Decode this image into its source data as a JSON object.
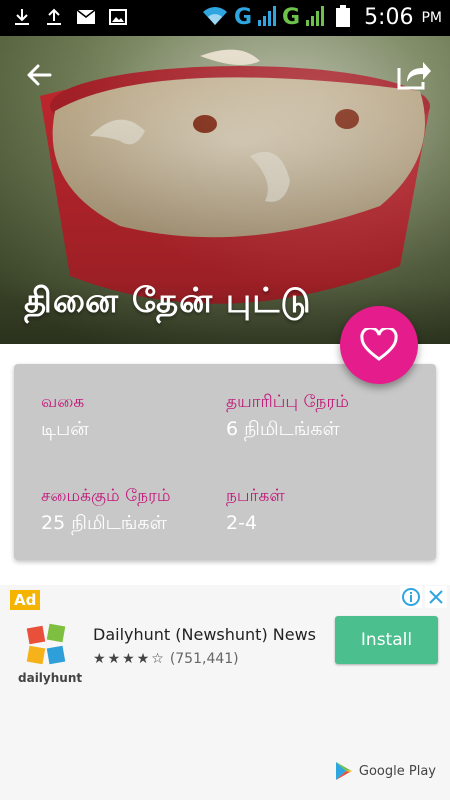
{
  "status_bar": {
    "network1": "G",
    "network2": "G",
    "time": "5:06",
    "ampm": "PM"
  },
  "recipe": {
    "title": "தினை தேன் புட்டு",
    "info": [
      {
        "label": "வகை",
        "value": "டிபன்"
      },
      {
        "label": "தயாரிப்பு நேரம்",
        "value": "6 நிமிடங்கள்"
      },
      {
        "label": "சமைக்கும் நேரம்",
        "value": "25 நிமிடங்கள்"
      },
      {
        "label": "நபர்கள்",
        "value": "2-4"
      }
    ]
  },
  "colors": {
    "accent": "#e51c8b",
    "label": "#c2177a",
    "card": "#c8c8c8",
    "install": "#4cbf8f"
  },
  "ad": {
    "badge": "Ad",
    "app_name": "Dailyhunt (Newshunt) News",
    "logo_text": "dailyhunt",
    "rating_stars": 4.5,
    "rating_count": "(751,441)",
    "install_label": "Install",
    "store_label": "Google Play"
  }
}
